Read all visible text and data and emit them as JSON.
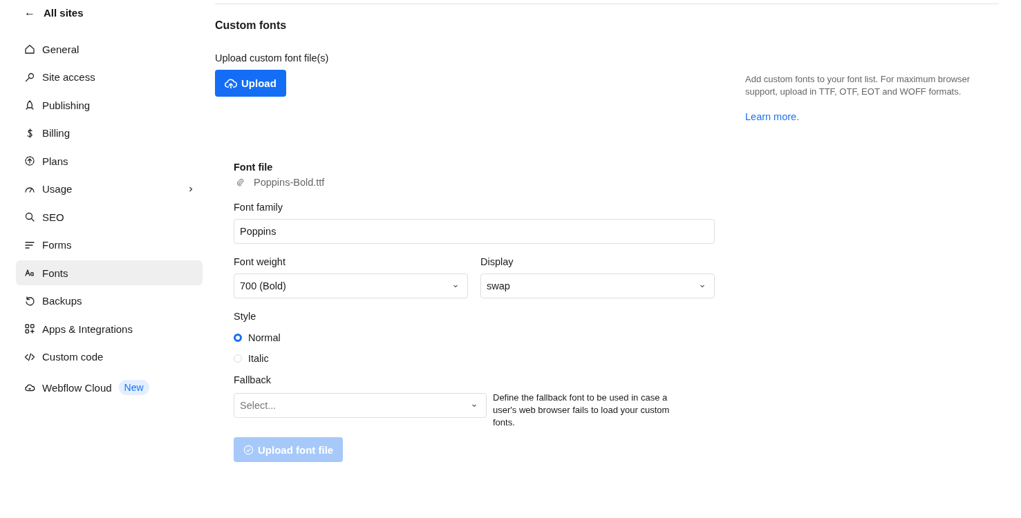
{
  "sidebar": {
    "back": {
      "icon": "←",
      "label": "All sites"
    },
    "items": [
      {
        "label": "General",
        "selected": false
      },
      {
        "label": "Site access",
        "selected": false
      },
      {
        "label": "Publishing",
        "selected": false
      },
      {
        "label": "Billing",
        "selected": false
      },
      {
        "label": "Plans",
        "selected": false
      },
      {
        "label": "Usage",
        "selected": false,
        "expandable": true
      },
      {
        "label": "SEO",
        "selected": false
      },
      {
        "label": "Forms",
        "selected": false
      },
      {
        "label": "Fonts",
        "selected": true
      },
      {
        "label": "Backups",
        "selected": false
      },
      {
        "label": "Apps & Integrations",
        "selected": false
      },
      {
        "label": "Custom code",
        "selected": false
      },
      {
        "label": "Webflow Cloud",
        "selected": false,
        "badge": "New"
      }
    ]
  },
  "section": {
    "title": "Custom fonts",
    "upload_label": "Upload custom font file(s)",
    "upload_button": "Upload",
    "help": {
      "text": "Add custom fonts to your font list. For maximum browser support, upload in TTF, OTF, EOT and WOFF formats.",
      "link": "Learn more",
      "link_suffix": "."
    }
  },
  "form": {
    "font_file": {
      "label": "Font file",
      "value": "Poppins-Bold.ttf"
    },
    "font_family": {
      "label": "Font family",
      "value": "Poppins"
    },
    "font_weight": {
      "label": "Font weight",
      "value": "700 (Bold)"
    },
    "display": {
      "label": "Display",
      "value": "swap"
    },
    "style": {
      "label": "Style",
      "options": [
        {
          "label": "Normal",
          "selected": true
        },
        {
          "label": "Italic",
          "selected": false
        }
      ]
    },
    "fallback": {
      "label": "Fallback",
      "placeholder": "Select...",
      "hint": "Define the fallback font to be used in case a user's web browser fails to load your custom fonts."
    },
    "submit": {
      "label": "Upload font file",
      "disabled": true
    }
  }
}
